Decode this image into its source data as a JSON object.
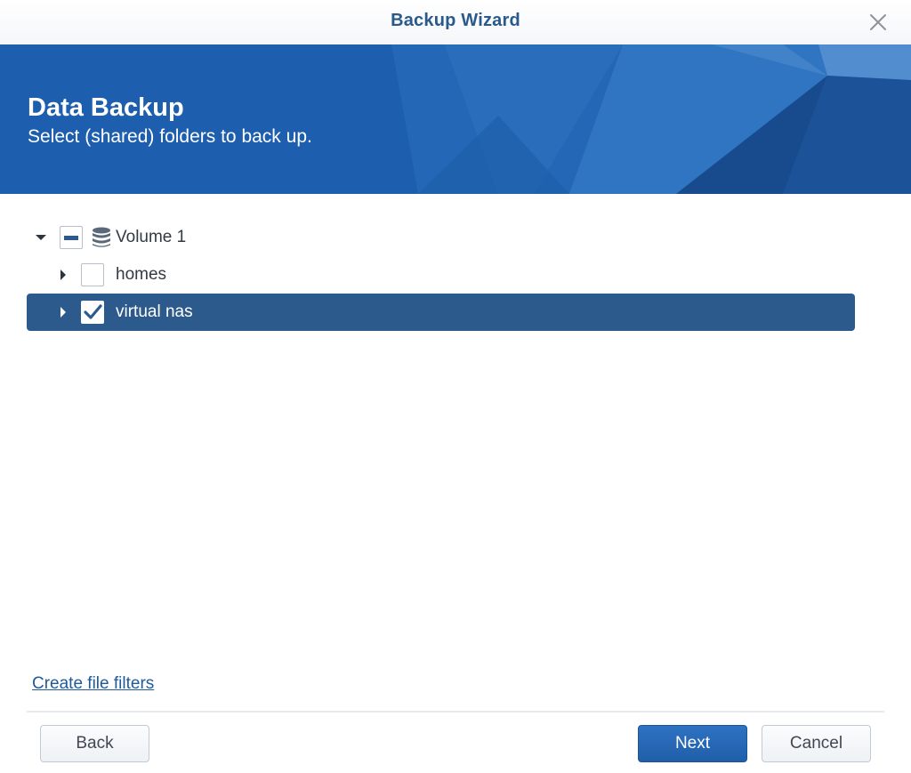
{
  "window": {
    "title": "Backup Wizard"
  },
  "banner": {
    "heading": "Data Backup",
    "subheading": "Select (shared) folders to back up."
  },
  "tree": {
    "items": [
      {
        "label": "Volume 1",
        "level": 0,
        "expanded": true,
        "checked": "partial",
        "icon": "database-icon",
        "selected": false
      },
      {
        "label": "homes",
        "level": 1,
        "expanded": false,
        "checked": "unchecked",
        "selected": false
      },
      {
        "label": "virtual nas",
        "level": 1,
        "expanded": false,
        "checked": "checked",
        "selected": true
      }
    ]
  },
  "footer": {
    "filters_link": "Create file filters",
    "back_label": "Back",
    "next_label": "Next",
    "cancel_label": "Cancel"
  },
  "colors": {
    "accent": "#1f5ea9",
    "selection": "#2d5a8c",
    "title_text": "#2a5a8c"
  }
}
